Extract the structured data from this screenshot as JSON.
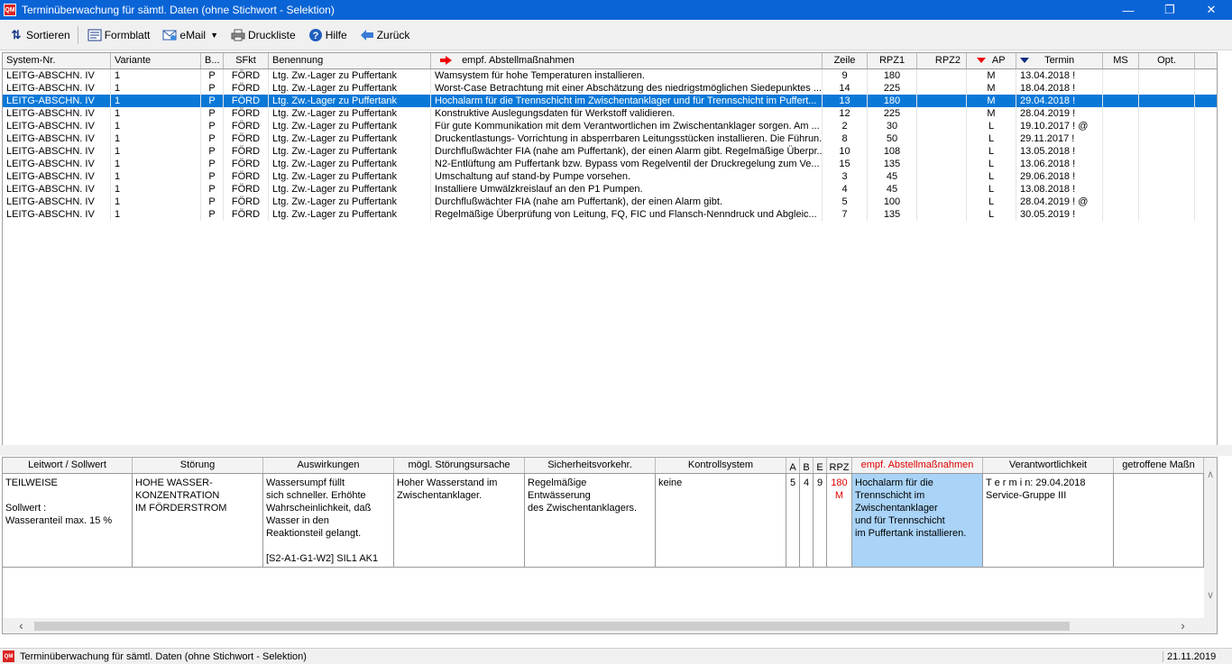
{
  "window": {
    "title": "Terminüberwachung für sämtl. Daten (ohne Stichwort - Selektion)",
    "app_icon": "QM"
  },
  "toolbar": {
    "sort_label": "Sortieren",
    "form_label": "Formblatt",
    "email_label": "eMail",
    "print_label": "Druckliste",
    "help_label": "Hilfe",
    "back_label": "Zurück"
  },
  "upper_table": {
    "headers": {
      "system": "System-Nr.",
      "variante": "Variante",
      "b": "B...",
      "sfkt": "SFkt",
      "benennung": "Benennung",
      "empf": "empf. Abstellmaßnahmen",
      "zeile": "Zeile",
      "rpz1": "RPZ1",
      "rpz2": "RPZ2",
      "ap": "AP",
      "termin": "Termin",
      "ms": "MS",
      "opt": "Opt."
    },
    "rows": [
      {
        "system": "LEITG-ABSCHN. IV",
        "variante": "1",
        "b": "P",
        "sfkt": "FÖRD",
        "benennung": "Ltg. Zw.-Lager zu Puffertank",
        "empf": "Wamsystem für hohe  Temperaturen installieren.",
        "zeile": "9",
        "rpz1": "180",
        "rpz2": "",
        "ap": "M",
        "termin": "13.04.2018 !",
        "ms": "",
        "opt": ""
      },
      {
        "system": "LEITG-ABSCHN. IV",
        "variante": "1",
        "b": "P",
        "sfkt": "FÖRD",
        "benennung": "Ltg. Zw.-Lager zu Puffertank",
        "empf": "Worst-Case Betrachtung mit  einer Abschätzung des  niedrigstmöglichen  Siedepunktes ...",
        "zeile": "14",
        "rpz1": "225",
        "rpz2": "",
        "ap": "M",
        "termin": "18.04.2018 !",
        "ms": "",
        "opt": ""
      },
      {
        "system": "LEITG-ABSCHN. IV",
        "variante": "1",
        "b": "P",
        "sfkt": "FÖRD",
        "benennung": "Ltg. Zw.-Lager zu Puffertank",
        "empf": "Hochalarm für die  Trennschicht im  Zwischentanklager und für Trennschicht  im Puffert...",
        "zeile": "13",
        "rpz1": "180",
        "rpz2": "",
        "ap": "M",
        "termin": "29.04.2018 !",
        "ms": "",
        "opt": ""
      },
      {
        "system": "LEITG-ABSCHN. IV",
        "variante": "1",
        "b": "P",
        "sfkt": "FÖRD",
        "benennung": "Ltg. Zw.-Lager zu Puffertank",
        "empf": "Konstruktive  Auslegungsdaten für Werkstoff validieren.",
        "zeile": "12",
        "rpz1": "225",
        "rpz2": "",
        "ap": "M",
        "termin": "28.04.2019 !",
        "ms": "",
        "opt": ""
      },
      {
        "system": "LEITG-ABSCHN. IV",
        "variante": "1",
        "b": "P",
        "sfkt": "FÖRD",
        "benennung": "Ltg. Zw.-Lager zu Puffertank",
        "empf": "Für gute Kommunikation  mit dem Verantwortlichen im  Zwischentanklager sorgen.  Am ...",
        "zeile": "2",
        "rpz1": "30",
        "rpz2": "",
        "ap": "L",
        "termin": "19.10.2017 ! @",
        "ms": "",
        "opt": ""
      },
      {
        "system": "LEITG-ABSCHN. IV",
        "variante": "1",
        "b": "P",
        "sfkt": "FÖRD",
        "benennung": "Ltg. Zw.-Lager zu Puffertank",
        "empf": "Druckentlastungs- Vorrichtung in absperrbaren  Leitungsstücken installieren. Die Führun...",
        "zeile": "8",
        "rpz1": "50",
        "rpz2": "",
        "ap": "L",
        "termin": "29.11.2017 !",
        "ms": "",
        "opt": ""
      },
      {
        "system": "LEITG-ABSCHN. IV",
        "variante": "1",
        "b": "P",
        "sfkt": "FÖRD",
        "benennung": "Ltg. Zw.-Lager zu Puffertank",
        "empf": "Durchflußwächter FIA (nahe am Puffertank),  der einen Alarm gibt.  Regelmäßige Überpr...",
        "zeile": "10",
        "rpz1": "108",
        "rpz2": "",
        "ap": "L",
        "termin": "13.05.2018 !",
        "ms": "",
        "opt": ""
      },
      {
        "system": "LEITG-ABSCHN. IV",
        "variante": "1",
        "b": "P",
        "sfkt": "FÖRD",
        "benennung": "Ltg. Zw.-Lager zu Puffertank",
        "empf": "N2-Entlüftung am  Puffertank bzw. Bypass  vom Regelventil der  Druckregelung zum Ve...",
        "zeile": "15",
        "rpz1": "135",
        "rpz2": "",
        "ap": "L",
        "termin": "13.06.2018 !",
        "ms": "",
        "opt": ""
      },
      {
        "system": "LEITG-ABSCHN. IV",
        "variante": "1",
        "b": "P",
        "sfkt": "FÖRD",
        "benennung": "Ltg. Zw.-Lager zu Puffertank",
        "empf": "Umschaltung auf stand-by Pumpe vorsehen.",
        "zeile": "3",
        "rpz1": "45",
        "rpz2": "",
        "ap": "L",
        "termin": "29.06.2018 !",
        "ms": "",
        "opt": ""
      },
      {
        "system": "LEITG-ABSCHN. IV",
        "variante": "1",
        "b": "P",
        "sfkt": "FÖRD",
        "benennung": "Ltg. Zw.-Lager zu Puffertank",
        "empf": "Installiere Umwälzkreislauf  an den P1 Pumpen.",
        "zeile": "4",
        "rpz1": "45",
        "rpz2": "",
        "ap": "L",
        "termin": "13.08.2018 !",
        "ms": "",
        "opt": ""
      },
      {
        "system": "LEITG-ABSCHN. IV",
        "variante": "1",
        "b": "P",
        "sfkt": "FÖRD",
        "benennung": "Ltg. Zw.-Lager zu Puffertank",
        "empf": "Durchflußwächter FIA (nahe am Puffertank),  der einen Alarm gibt.",
        "zeile": "5",
        "rpz1": "100",
        "rpz2": "",
        "ap": "L",
        "termin": "28.04.2019 ! @",
        "ms": "",
        "opt": ""
      },
      {
        "system": "LEITG-ABSCHN. IV",
        "variante": "1",
        "b": "P",
        "sfkt": "FÖRD",
        "benennung": "Ltg. Zw.-Lager zu Puffertank",
        "empf": "Regelmäßige Überprüfung  von Leitung, FQ, FIC und  Flansch-Nenndruck und  Abgleic...",
        "zeile": "7",
        "rpz1": "135",
        "rpz2": "",
        "ap": "L",
        "termin": "30.05.2019 !",
        "ms": "",
        "opt": ""
      }
    ],
    "selected_row_index": 2
  },
  "lower_table": {
    "headers": {
      "leitwort": "Leitwort / Sollwert",
      "stoerung": "Störung",
      "auswirkungen": "Auswirkungen",
      "ursache": "mögl. Störungsursache",
      "sicherheit": "Sicherheitsvorkehr.",
      "kontroll": "Kontrollsystem",
      "a": "A",
      "b": "B",
      "e": "E",
      "rpz": "RPZ",
      "empf": "empf. Abstellmaßnahmen",
      "verantw": "Verantwortlichkeit",
      "getroffen": "getroffene Maßn"
    },
    "row": {
      "leitwort": "TEILWEISE\n\nSollwert :\nWasseranteil max. 15 %",
      "stoerung": "HOHE WASSER-\nKONZENTRATION\nIM FÖRDERSTROM",
      "auswirkungen": "Wassersumpf füllt\nsich schneller. Erhöhte\nWahrscheinlichkeit, daß\nWasser in den\nReaktionsteil gelangt.\n\n[S2-A1-G1-W2] SIL1 AK1",
      "ursache": "Hoher Wasserstand im\nZwischentanklager.",
      "sicherheit": "Regelmäßige Entwässerung\ndes Zwischentanklagers.",
      "kontroll": "keine",
      "a": "5",
      "b": "4",
      "e": "9",
      "rpz": "180\nM",
      "empf": "Hochalarm für die\nTrennschicht im\nZwischentanklager\nund für Trennschicht\nim Puffertank installieren.",
      "verantw": "T e r m i n: 29.04.2018\nService-Gruppe III",
      "getroffen": ""
    }
  },
  "statusbar": {
    "text": "Terminüberwachung für sämtl. Daten (ohne Stichwort - Selektion)",
    "date": "21.11.2019"
  },
  "colors": {
    "titlebar": "#0a64d6",
    "selection": "#0a78d7",
    "highlight_cell": "#a9d3f7",
    "red_text": "#e00000"
  }
}
